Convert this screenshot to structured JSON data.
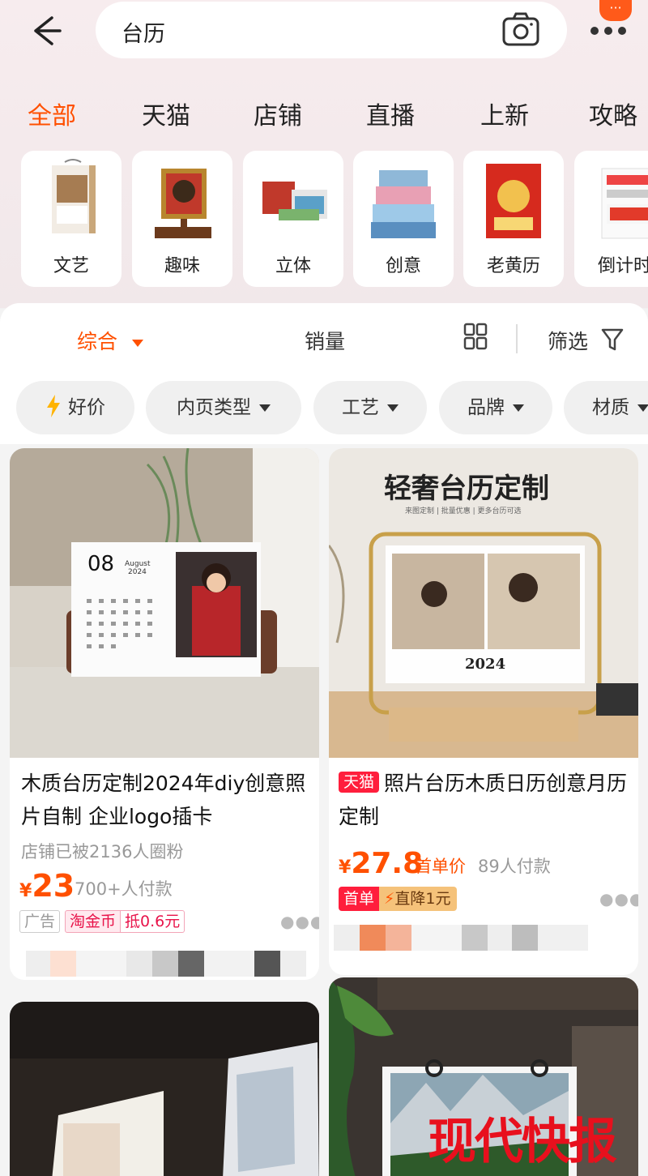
{
  "search": {
    "query": "台历"
  },
  "notif": {
    "text": "···"
  },
  "tabs": [
    {
      "label": "全部"
    },
    {
      "label": "天猫"
    },
    {
      "label": "店铺"
    },
    {
      "label": "直播"
    },
    {
      "label": "上新"
    },
    {
      "label": "攻略"
    }
  ],
  "categories": [
    {
      "label": "文艺"
    },
    {
      "label": "趣味"
    },
    {
      "label": "立体"
    },
    {
      "label": "创意"
    },
    {
      "label": "老黄历"
    },
    {
      "label": "倒计时"
    }
  ],
  "sort": {
    "comprehensive": "综合",
    "sales": "销量",
    "filter": "筛选"
  },
  "chips": [
    {
      "label": "好价"
    },
    {
      "label": "内页类型"
    },
    {
      "label": "工艺"
    },
    {
      "label": "品牌"
    },
    {
      "label": "材质"
    }
  ],
  "products": [
    {
      "title": "木质台历定制2024年diy创意照片自制 企业logo插卡",
      "shop_fans": "店铺已被2136人圈粉",
      "currency": "¥",
      "price": "23",
      "sales": "700+人付款",
      "tag_ad": "广告",
      "tag_coin": "淘金币",
      "tag_discount": "抵0.6元",
      "img_month": "08",
      "img_month_name": "August",
      "img_year": "2024"
    },
    {
      "badge": "天猫",
      "title": "照片台历木质日历创意月历定制",
      "currency": "¥",
      "price": "27.8",
      "price_tag": "首单价",
      "sales": "89人付款",
      "promo_first": "首单",
      "promo_drop": "直降1元",
      "img_heading": "轻奢台历定制",
      "img_sub": "来图定制 | 批量优惠 | 更多台历可选",
      "img_year": "2024"
    }
  ],
  "watermark": "现代快报",
  "colors": {
    "accent": "#ff5000",
    "tmall": "#ff1e3c"
  }
}
